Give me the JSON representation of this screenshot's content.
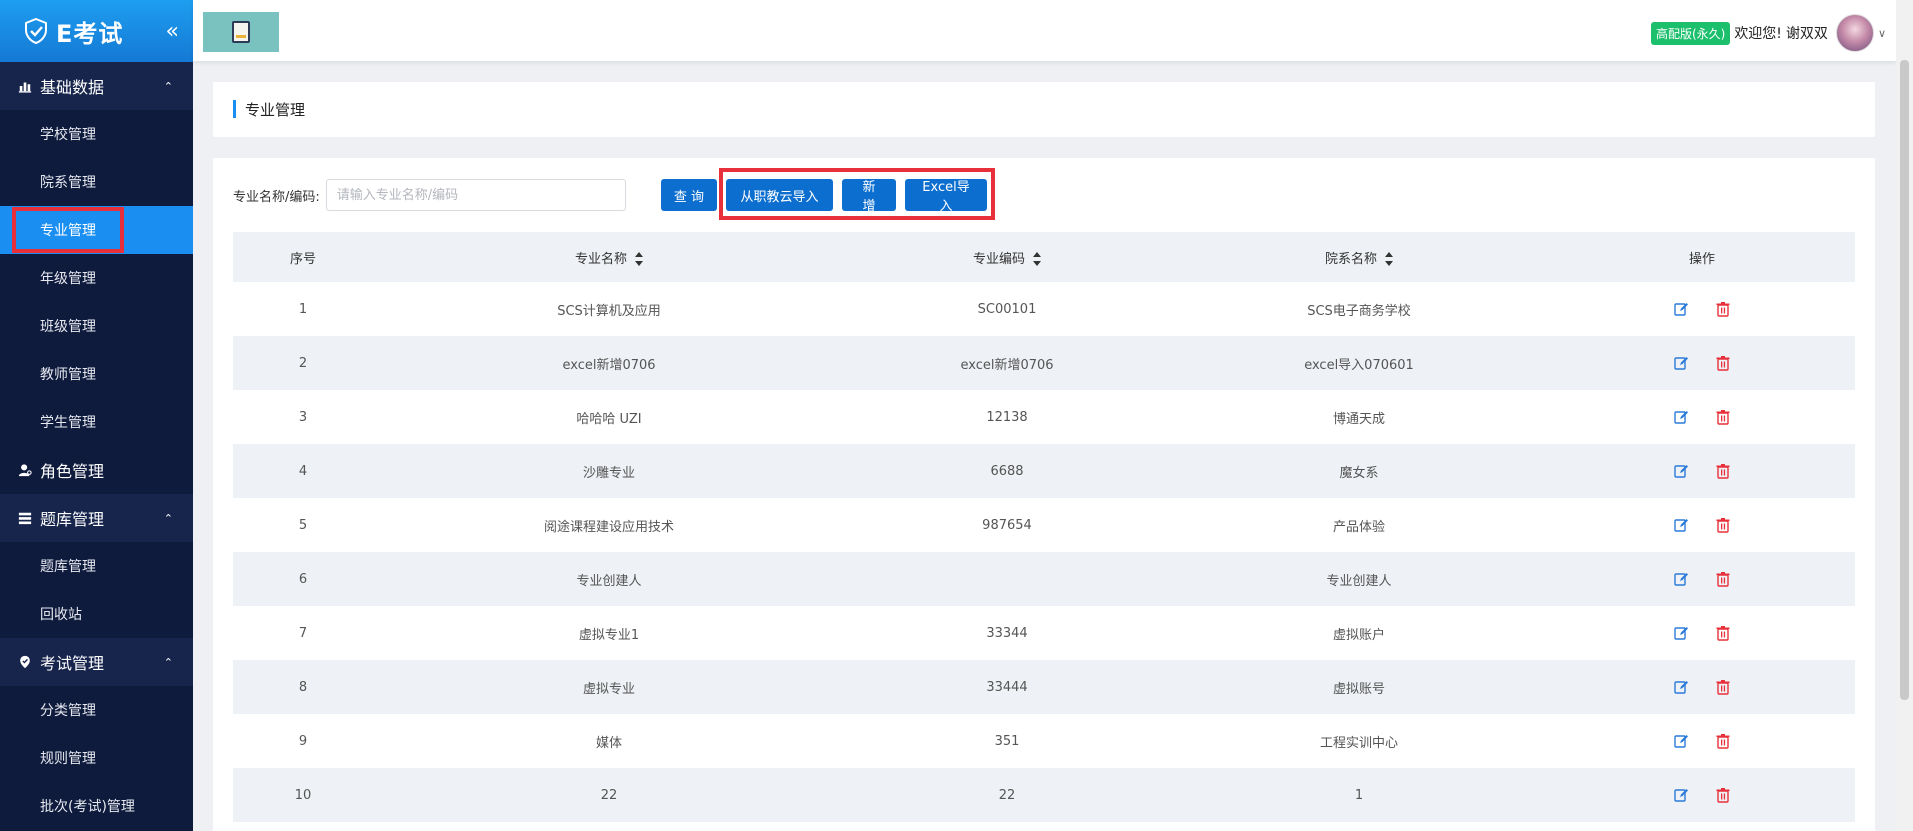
{
  "brand": {
    "name": "E考试",
    "collapse_glyph": "«"
  },
  "sidebar": {
    "groups": [
      {
        "label": "基础数据",
        "items": [
          "学校管理",
          "院系管理",
          "专业管理",
          "年级管理",
          "班级管理",
          "教师管理",
          "学生管理"
        ]
      },
      {
        "label": "角色管理",
        "items": []
      },
      {
        "label": "题库管理",
        "items": [
          "题库管理",
          "回收站"
        ]
      },
      {
        "label": "考试管理",
        "items": [
          "分类管理",
          "规则管理",
          "批次(考试)管理"
        ]
      }
    ],
    "active_item": "专业管理"
  },
  "header": {
    "badge": "高配版(永久)",
    "welcome": "欢迎您!",
    "username": "谢双双"
  },
  "page": {
    "title": "专业管理"
  },
  "filter": {
    "label": "专业名称/编码:",
    "placeholder": "请输入专业名称/编码",
    "value": ""
  },
  "buttons": {
    "query": "查 询",
    "import_cloud": "从职教云导入",
    "add": "新 增",
    "excel_import": "Excel导入"
  },
  "table": {
    "columns": [
      "序号",
      "专业名称",
      "专业编码",
      "院系名称",
      "操作"
    ],
    "rows": [
      {
        "idx": "1",
        "name": "SCS计算机及应用",
        "code": "SC00101",
        "dept": "SCS电子商务学校"
      },
      {
        "idx": "2",
        "name": "excel新增0706",
        "code": "excel新增0706",
        "dept": "excel导入070601"
      },
      {
        "idx": "3",
        "name": "哈哈哈 UZI",
        "code": "12138",
        "dept": "博通天成"
      },
      {
        "idx": "4",
        "name": "沙雕专业",
        "code": "6688",
        "dept": "魔女系"
      },
      {
        "idx": "5",
        "name": "阅途课程建设应用技术",
        "code": "987654",
        "dept": "产品体验"
      },
      {
        "idx": "6",
        "name": "专业创建人",
        "code": "",
        "dept": "专业创建人"
      },
      {
        "idx": "7",
        "name": "虚拟专业1",
        "code": "33344",
        "dept": "虚拟账户"
      },
      {
        "idx": "8",
        "name": "虚拟专业",
        "code": "33444",
        "dept": "虚拟账号"
      },
      {
        "idx": "9",
        "name": "媒体",
        "code": "351",
        "dept": "工程实训中心"
      },
      {
        "idx": "10",
        "name": "22",
        "code": "22",
        "dept": "1"
      }
    ]
  },
  "colors": {
    "sidebar_bg": "#0f1b3d",
    "active_item": "#1a8ff1",
    "primary_button": "#0c6fcf",
    "highlight": "#e8303a",
    "badge": "#1cbf6b"
  },
  "icons": {
    "edit": "edit-icon",
    "delete": "trash-icon"
  }
}
